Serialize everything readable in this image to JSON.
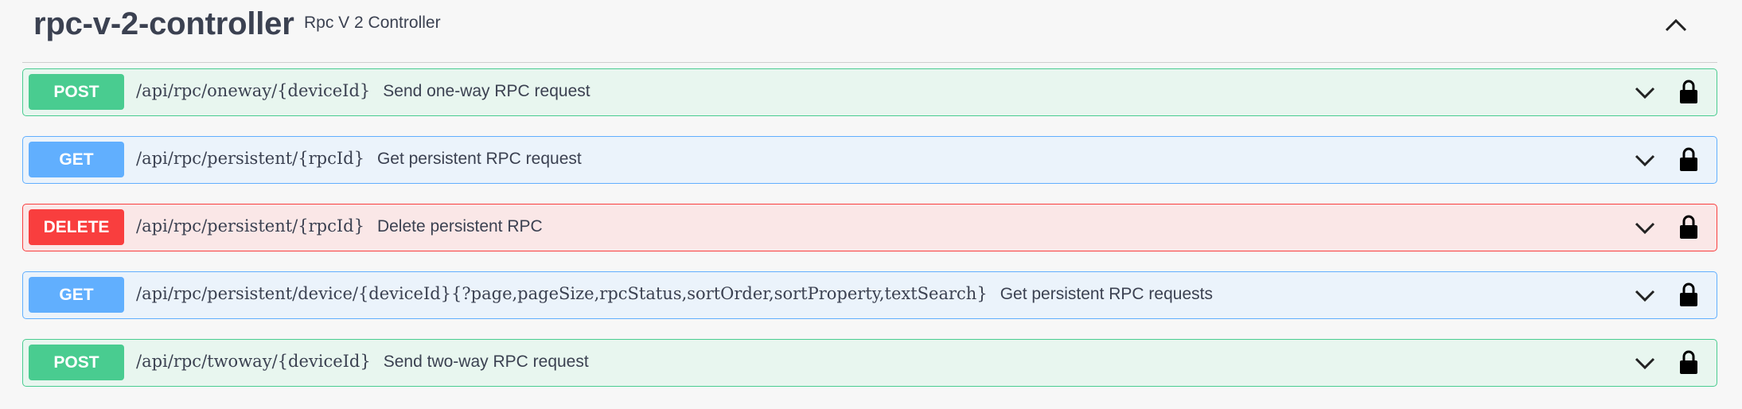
{
  "section": {
    "title": "rpc-v-2-controller",
    "description": "Rpc V 2 Controller"
  },
  "operations": [
    {
      "method": "POST",
      "path": "/api/rpc/oneway/{deviceId}",
      "summary": "Send one-way RPC request"
    },
    {
      "method": "GET",
      "path": "/api/rpc/persistent/{rpcId}",
      "summary": "Get persistent RPC request"
    },
    {
      "method": "DELETE",
      "path": "/api/rpc/persistent/{rpcId}",
      "summary": "Delete persistent RPC"
    },
    {
      "method": "GET",
      "path": "/api/rpc/persistent/device/{deviceId}{?page,pageSize,rpcStatus,sortOrder,sortProperty,textSearch}",
      "summary": "Get persistent RPC requests"
    },
    {
      "method": "POST",
      "path": "/api/rpc/twoway/{deviceId}",
      "summary": "Send two-way RPC request"
    }
  ],
  "icons": {
    "collapse": "chevron-up-icon",
    "expand": "chevron-down-icon",
    "lock": "lock-icon"
  },
  "colors": {
    "post": "#49cc90",
    "get": "#61affe",
    "delete": "#f93e3e",
    "text": "#3b4151"
  }
}
